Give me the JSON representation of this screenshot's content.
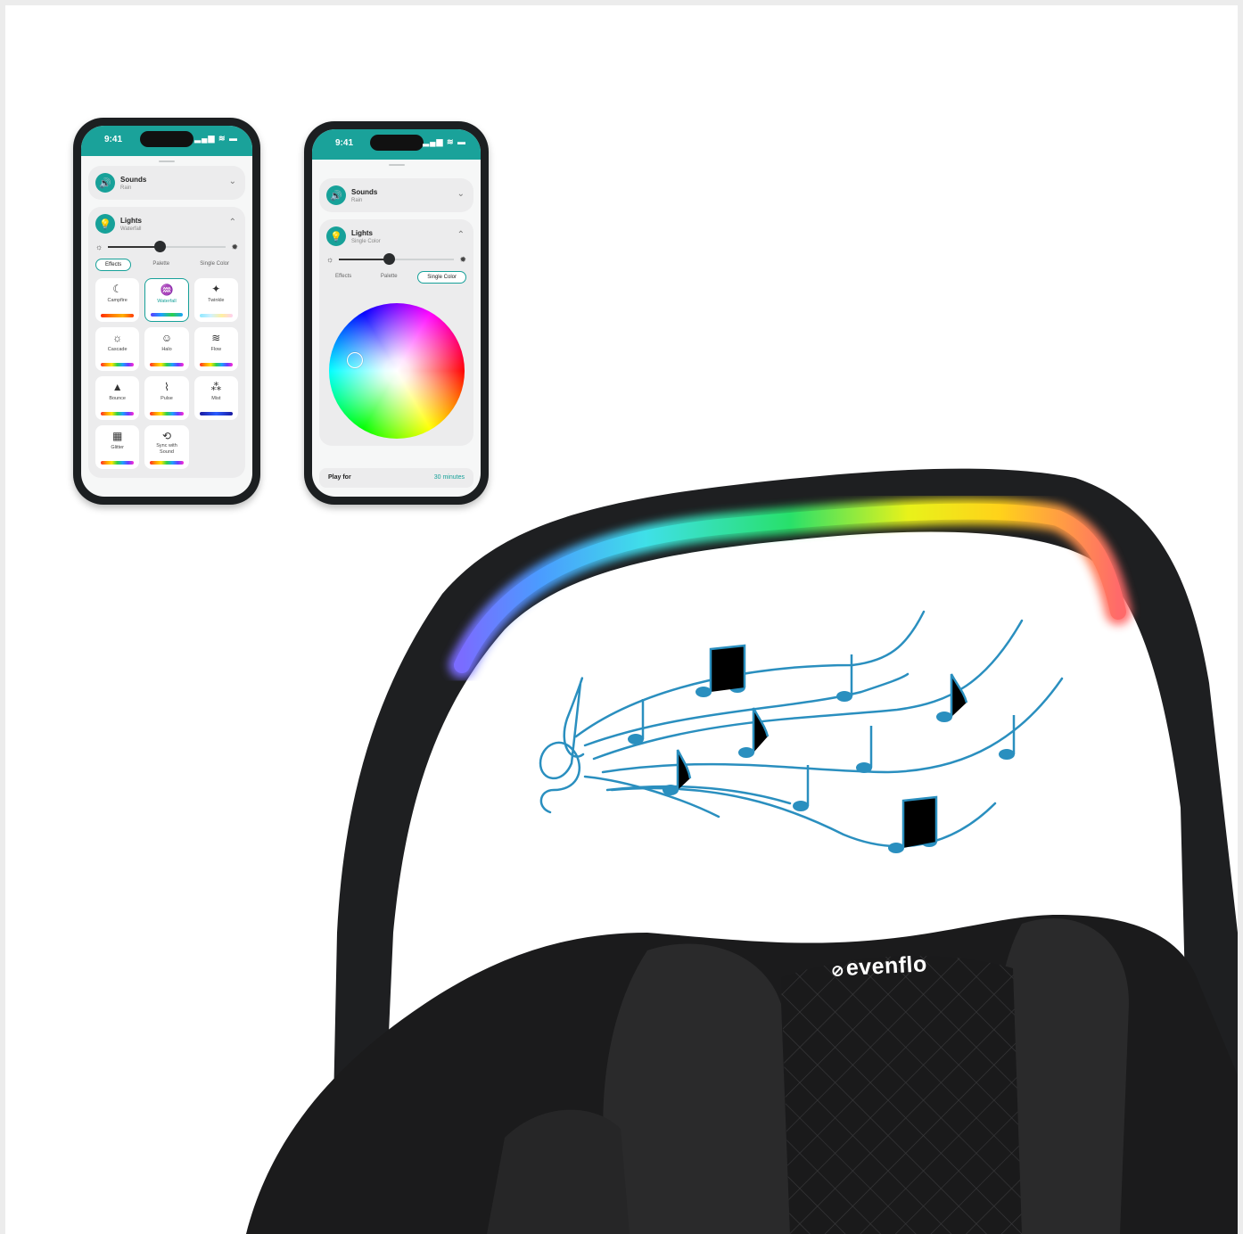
{
  "phone_left": {
    "status_time": "9:41",
    "status_icons": "▂▄▆ ≋ ▬",
    "sounds": {
      "title": "Sounds",
      "subtitle": "Rain",
      "icon": "speaker-icon"
    },
    "lights": {
      "title": "Lights",
      "subtitle": "Waterfall",
      "icon": "bulb-icon",
      "brightness_fraction": 0.45
    },
    "tabs": [
      "Effects",
      "Palette",
      "Single Color"
    ],
    "active_tab": "Effects",
    "effects": [
      {
        "label": "Campfire",
        "icon": "moon-icon",
        "glyph": "☾"
      },
      {
        "label": "Waterfall",
        "icon": "waterfall-icon",
        "glyph": "♒",
        "selected": true
      },
      {
        "label": "Twinkle",
        "icon": "twinkle-icon",
        "glyph": "✦"
      },
      {
        "label": "Cascade",
        "icon": "sun-icon",
        "glyph": "☼"
      },
      {
        "label": "Halo",
        "icon": "smiley-icon",
        "glyph": "☺"
      },
      {
        "label": "Flow",
        "icon": "waves-icon",
        "glyph": "≋"
      },
      {
        "label": "Bounce",
        "icon": "bounce-icon",
        "glyph": "▲"
      },
      {
        "label": "Pulse",
        "icon": "pulse-icon",
        "glyph": "⌇"
      },
      {
        "label": "Mist",
        "icon": "droplets-icon",
        "glyph": "⁂"
      },
      {
        "label": "Glitter",
        "icon": "glitter-icon",
        "glyph": "▦"
      },
      {
        "label": "Sync with Sound",
        "icon": "sync-icon",
        "glyph": "⟲"
      }
    ]
  },
  "phone_right": {
    "status_time": "9:41",
    "status_icons": "▂▄▆ ≋ ▬",
    "sounds": {
      "title": "Sounds",
      "subtitle": "Rain",
      "icon": "speaker-icon"
    },
    "lights": {
      "title": "Lights",
      "subtitle": "Single Color",
      "icon": "bulb-icon",
      "brightness_fraction": 0.45
    },
    "tabs": [
      "Effects",
      "Palette",
      "Single Color"
    ],
    "active_tab": "Single Color",
    "play_for": {
      "label": "Play for",
      "value": "30 minutes"
    }
  },
  "brand": {
    "logo_text": "evenflo",
    "accent": "#17a199"
  },
  "colors": {
    "app_header": "#1aa29a",
    "music_notes": "#2a8fbf",
    "seat": "#1d1d1f"
  }
}
